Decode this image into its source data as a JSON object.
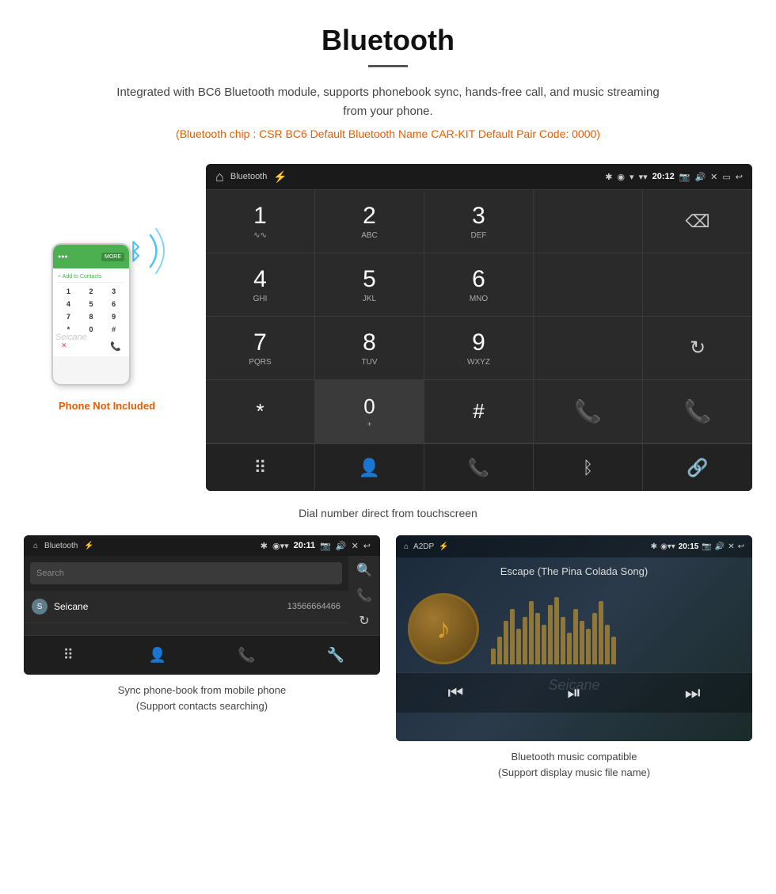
{
  "header": {
    "title": "Bluetooth",
    "description": "Integrated with BC6 Bluetooth module, supports phonebook sync, hands-free call, and music streaming from your phone.",
    "specs": "(Bluetooth chip : CSR BC6    Default Bluetooth Name CAR-KIT    Default Pair Code: 0000)"
  },
  "phone_note": "Phone Not Included",
  "dial_screen": {
    "status_bar": {
      "app_name": "Bluetooth",
      "time": "20:12"
    },
    "dialpad": {
      "keys": [
        {
          "number": "1",
          "letters": "∿∿"
        },
        {
          "number": "2",
          "letters": "ABC"
        },
        {
          "number": "3",
          "letters": "DEF"
        },
        {
          "number": "4",
          "letters": "GHI"
        },
        {
          "number": "5",
          "letters": "JKL"
        },
        {
          "number": "6",
          "letters": "MNO"
        },
        {
          "number": "7",
          "letters": "PQRS"
        },
        {
          "number": "8",
          "letters": "TUV"
        },
        {
          "number": "9",
          "letters": "WXYZ"
        },
        {
          "number": "*",
          "letters": ""
        },
        {
          "number": "0",
          "letters": "+"
        },
        {
          "number": "#",
          "letters": ""
        }
      ]
    },
    "caption": "Dial number direct from touchscreen"
  },
  "phonebook_screen": {
    "status_bar": {
      "app_name": "Bluetooth",
      "time": "20:11"
    },
    "search_placeholder": "Search",
    "contacts": [
      {
        "initial": "S",
        "name": "Seicane",
        "number": "13566664466"
      }
    ],
    "caption_line1": "Sync phone-book from mobile phone",
    "caption_line2": "(Support contacts searching)"
  },
  "music_screen": {
    "status_bar": {
      "app_name": "A2DP",
      "time": "20:15"
    },
    "song_title": "Escape (The Pina Colada Song)",
    "caption_line1": "Bluetooth music compatible",
    "caption_line2": "(Support display music file name)"
  },
  "eq_bars": [
    20,
    35,
    55,
    70,
    45,
    60,
    80,
    65,
    50,
    75,
    85,
    60,
    40,
    70,
    55,
    45,
    65,
    80,
    50,
    35
  ]
}
